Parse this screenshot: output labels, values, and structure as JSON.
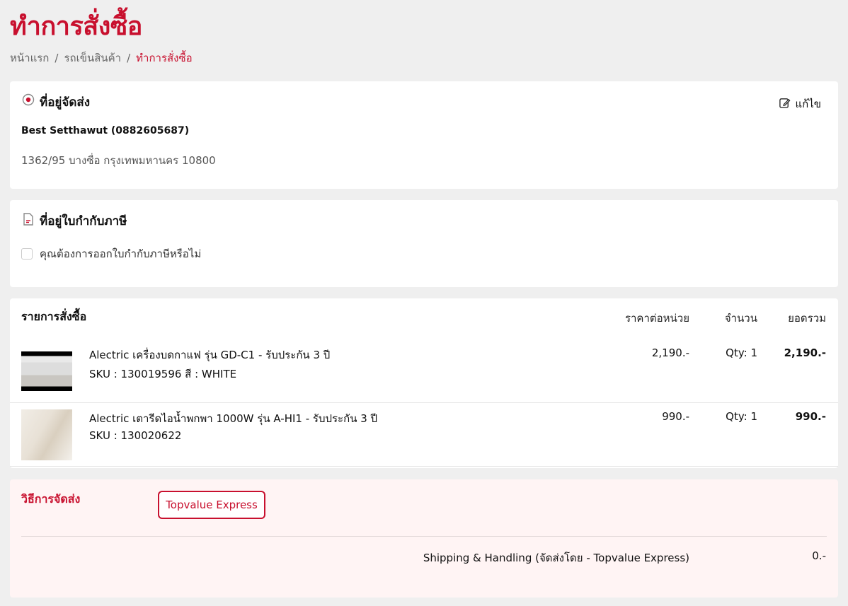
{
  "page_title": "ทำการสั่งซื้อ",
  "breadcrumb": {
    "home": "หน้าแรก",
    "cart": "รถเข็นสินค้า",
    "current": "ทำการสั่งซื้อ",
    "separator": "/"
  },
  "shipping_address": {
    "title": "ที่อยู่จัดส่ง",
    "edit_label": "แก้ไข",
    "name": "Best Setthawut (0882605687)",
    "address": "1362/95 บางซื่อ กรุงเทพมหานคร 10800"
  },
  "tax_invoice": {
    "title": "ที่อยู่ใบกำกับภาษี",
    "checkbox_label": "คุณต้องการออกใบกำกับภาษีหรือไม่"
  },
  "order": {
    "title": "รายการสั่งซื้อ",
    "col_unit_price": "ราคาต่อหน่วย",
    "col_qty": "จำนวน",
    "col_total": "ยอดรวม",
    "items": [
      {
        "name": "Alectric เครื่องบดกาแฟ รุ่น GD-C1 - รับประกัน 3 ปี",
        "sku": "SKU : 130019596 สี : WHITE",
        "price": "2,190.-",
        "qty": "Qty: 1",
        "total": "2,190.-"
      },
      {
        "name": "Alectric เตารีดไอน้ำพกพา 1000W รุ่น A-HI1 - รับประกัน 3 ปี",
        "sku": "SKU : 130020622",
        "price": "990.-",
        "qty": "Qty: 1",
        "total": "990.-"
      }
    ]
  },
  "shipping": {
    "label": "วิธีการจัดส่ง",
    "option": "Topvalue Express",
    "fee_label": "Shipping & Handling (จัดส่งโดย - Topvalue Express)",
    "fee_value": "0.-"
  },
  "colors": {
    "brand": "#c8102e",
    "background": "#efefef",
    "ship_bg": "#fff4f4"
  }
}
